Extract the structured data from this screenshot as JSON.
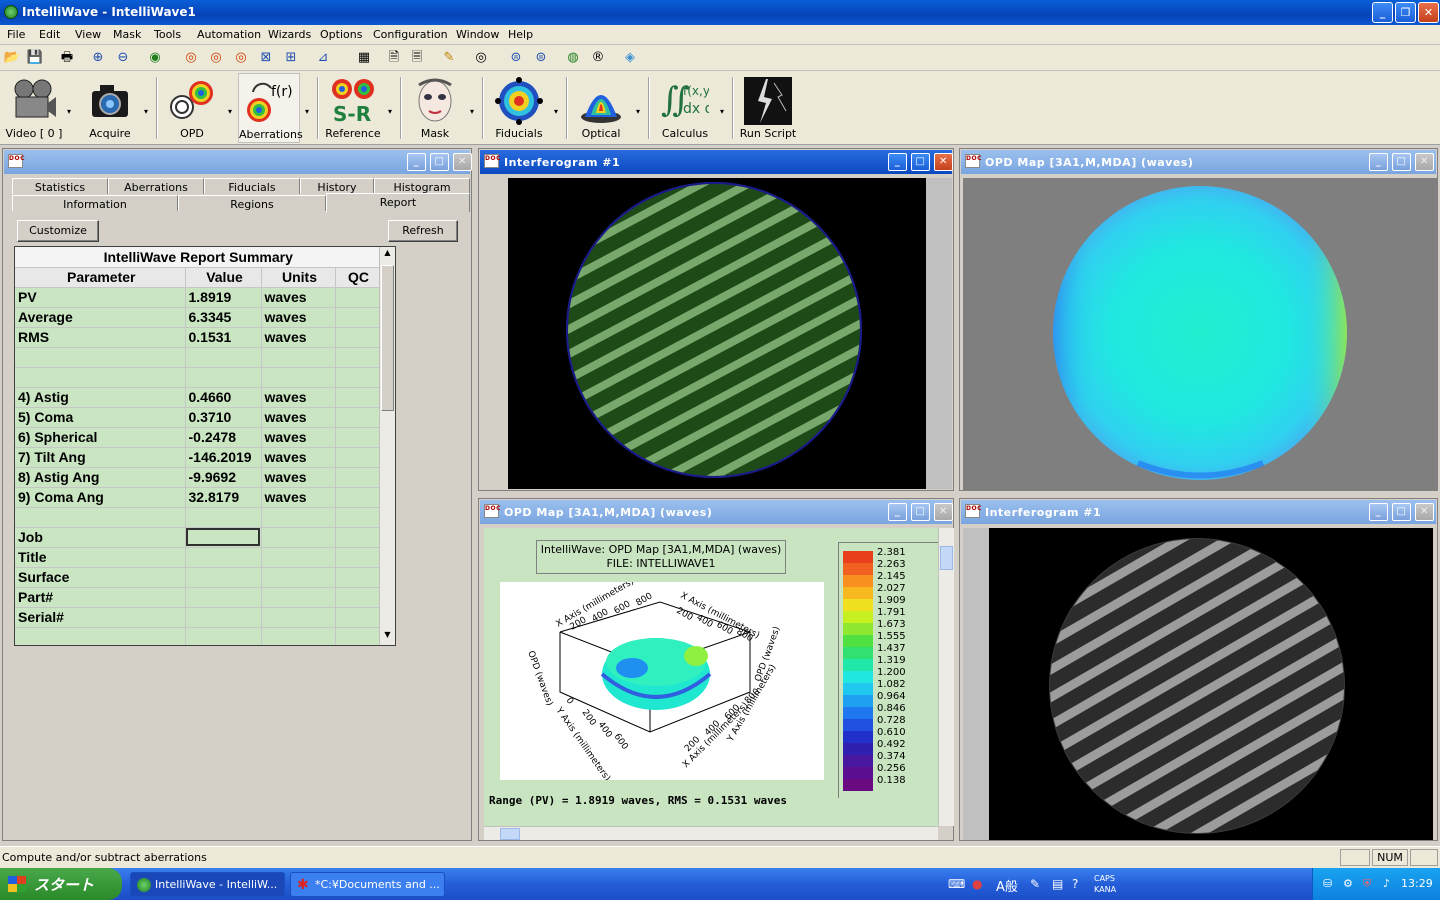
{
  "app": {
    "title": "IntelliWave - IntelliWave1"
  },
  "menu": [
    "File",
    "Edit",
    "View",
    "Mask",
    "Tools",
    "Automation",
    "Wizards",
    "Options",
    "Configuration",
    "Window",
    "Help"
  ],
  "toolbar_big": [
    {
      "label": "Video [ 0 ]",
      "icon": "video-camera-icon"
    },
    {
      "label": "Acquire",
      "icon": "camera-icon"
    },
    {
      "label": "OPD",
      "icon": "opd-icon"
    },
    {
      "label": "Aberrations",
      "icon": "aberrations-icon",
      "overlay": "f(r)"
    },
    {
      "label": "Reference",
      "icon": "reference-icon",
      "overlay": "S-R"
    },
    {
      "label": "Mask",
      "icon": "mask-icon"
    },
    {
      "label": "Fiducials",
      "icon": "fiducials-icon"
    },
    {
      "label": "Optical",
      "icon": "optical-icon"
    },
    {
      "label": "Calculus",
      "icon": "calculus-icon",
      "overlay": "∬f(x,y) dx dy"
    },
    {
      "label": "Run Script",
      "icon": "lightning-icon"
    }
  ],
  "panel_report": {
    "tabs_row1": [
      "Statistics",
      "Aberrations",
      "Fiducials",
      "History",
      "Histogram"
    ],
    "tabs_row2": [
      "Information",
      "Regions",
      "Report"
    ],
    "customize_label": "Customize",
    "refresh_label": "Refresh",
    "table_title": "IntelliWave Report Summary",
    "columns": [
      "Parameter",
      "Value",
      "Units",
      "QC"
    ],
    "rows": [
      [
        "PV",
        "1.8919",
        "waves",
        ""
      ],
      [
        "Average",
        "6.3345",
        "waves",
        ""
      ],
      [
        "RMS",
        "0.1531",
        "waves",
        ""
      ],
      [
        "",
        "",
        "",
        ""
      ],
      [
        "",
        "",
        "",
        ""
      ],
      [
        " 4) Astig",
        "0.4660",
        "waves",
        ""
      ],
      [
        " 5) Coma",
        "0.3710",
        "waves",
        ""
      ],
      [
        " 6) Spherical",
        "-0.2478",
        "waves",
        ""
      ],
      [
        " 7) Tilt Ang",
        "-146.2019",
        "waves",
        ""
      ],
      [
        " 8) Astig Ang",
        "-9.9692",
        "waves",
        ""
      ],
      [
        " 9) Coma Ang",
        "32.8179",
        "waves",
        ""
      ],
      [
        "",
        "",
        "",
        ""
      ],
      [
        "Job",
        "",
        "",
        ""
      ],
      [
        "Title",
        "",
        "",
        ""
      ],
      [
        "Surface",
        "",
        "",
        ""
      ],
      [
        "Part#",
        "",
        "",
        ""
      ],
      [
        "Serial#",
        "",
        "",
        ""
      ],
      [
        "",
        "",
        "",
        ""
      ]
    ]
  },
  "win_interf1": {
    "title": "Interferogram #1"
  },
  "win_opd1": {
    "title": "OPD Map [3A1,M,MDA]  (waves)"
  },
  "win_opd3d": {
    "title": "OPD Map [3A1,M,MDA]  (waves)",
    "caption1": "IntelliWave: OPD Map [3A1,M,MDA]  (waves)",
    "caption2": "FILE: INTELLIWAVE1",
    "range_text": "Range (PV) =   1.8919 waves, RMS =   0.1531 waves",
    "axis_x": "X Axis (millimeters)",
    "axis_y": "Y Axis (millimeters)",
    "axis_z": "OPD (waves)",
    "ticks_x": [
      "200",
      "400",
      "600",
      "800"
    ],
    "ticks_y": [
      "0",
      "200",
      "400",
      "600"
    ],
    "colorbar": [
      "2.381",
      "2.263",
      "2.145",
      "2.027",
      "1.909",
      "1.791",
      "1.673",
      "1.555",
      "1.437",
      "1.319",
      "1.200",
      "1.082",
      "0.964",
      "0.846",
      "0.728",
      "0.610",
      "0.492",
      "0.374",
      "0.256",
      "0.138"
    ],
    "colorbar_colors": [
      "#e8401a",
      "#f06020",
      "#f89020",
      "#f8b820",
      "#f0e020",
      "#c8f020",
      "#90e830",
      "#50e040",
      "#30e070",
      "#20e8a8",
      "#20e8e0",
      "#20c8f0",
      "#20a0f0",
      "#2078f0",
      "#2050e0",
      "#2030c8",
      "#3020b0",
      "#4818a0",
      "#5a1090",
      "#6a0a80"
    ]
  },
  "win_interf2": {
    "title": "Interferogram #1"
  },
  "status": {
    "message": "Compute and/or subtract aberrations",
    "num": "NUM"
  },
  "taskbar": {
    "start": "スタート",
    "tasks": [
      "IntelliWave - IntelliW...",
      "*C:¥Documents and ..."
    ],
    "time": "13:29",
    "ime": "A般",
    "caps": "CAPS",
    "kana": "KANA"
  }
}
